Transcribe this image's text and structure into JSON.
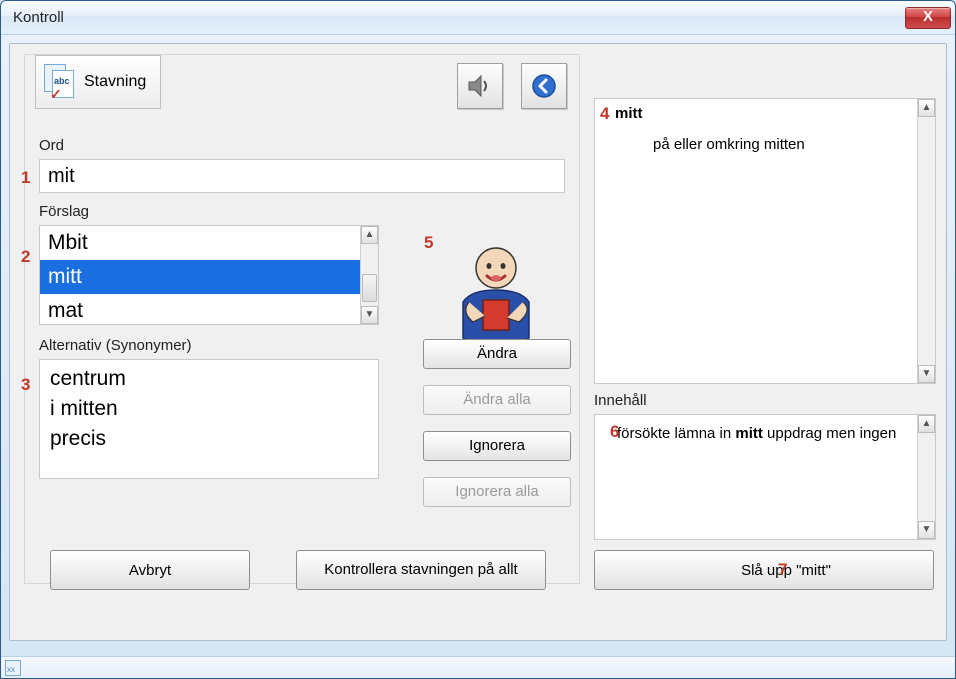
{
  "window": {
    "title": "Kontroll",
    "close_label": "X"
  },
  "tabs": {
    "spelling": "Stavning"
  },
  "labels": {
    "ord": "Ord",
    "forslag": "Förslag",
    "alternativ": "Alternativ (Synonymer)",
    "innehall": "Innehåll"
  },
  "word": {
    "value": "mit"
  },
  "suggestions": {
    "items": [
      "Mbit",
      "mitt",
      "mat"
    ],
    "selected_index": 1
  },
  "synonyms": [
    "centrum",
    "i mitten",
    "precis"
  ],
  "actions": {
    "andra": "Ändra",
    "andra_alla": "Ändra alla",
    "ignorera": "Ignorera",
    "ignorera_alla": "Ignorera alla"
  },
  "bottom": {
    "avbryt": "Avbryt",
    "kontrollera": "Kontrollera stavningen på allt",
    "sla_upp": "Slå upp \"mitt\""
  },
  "definition": {
    "headword": "mitt",
    "text": "på eller omkring mitten"
  },
  "context": {
    "before": "försökte lämna in ",
    "highlight": "mitt",
    "after": " uppdrag men ingen"
  },
  "markers": {
    "1": "1",
    "2": "2",
    "3": "3",
    "4": "4",
    "5": "5",
    "6": "6",
    "7": "7"
  }
}
